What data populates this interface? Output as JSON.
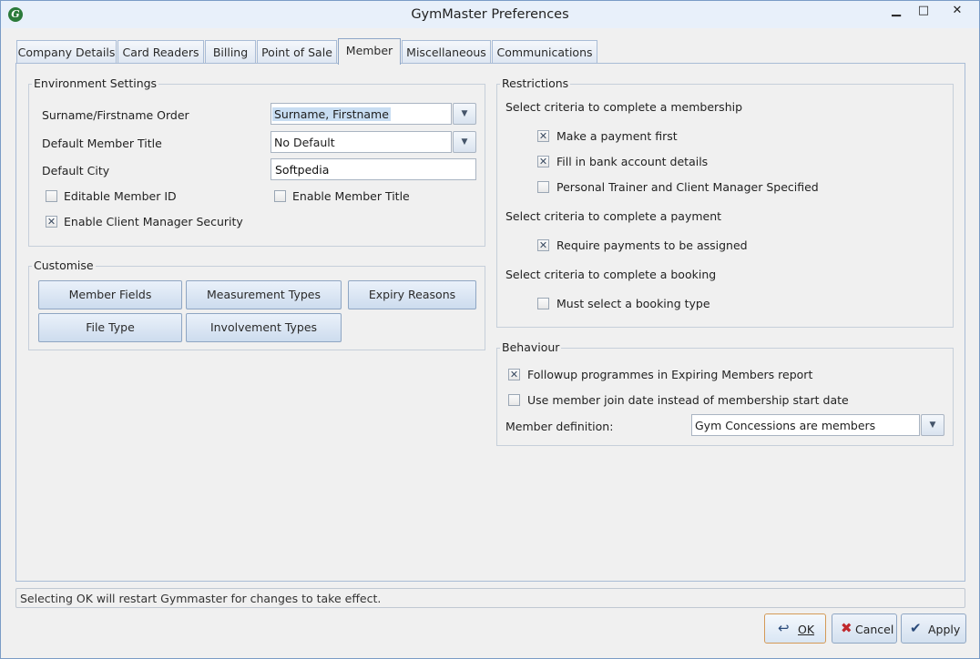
{
  "window": {
    "title": "GymMaster Preferences",
    "app_icon": "gymmaster-icon",
    "controls": {
      "minimize": "▁",
      "maximize": "□",
      "close": "✕"
    }
  },
  "tabs": [
    "Company Details",
    "Card Readers",
    "Billing",
    "Point of Sale",
    "Member",
    "Miscellaneous",
    "Communications"
  ],
  "active_tab": "Member",
  "environment": {
    "title": "Environment Settings",
    "surname_order_label": "Surname/Firstname Order",
    "surname_order_value": "Surname, Firstname",
    "member_title_label": "Default Member Title",
    "member_title_value": "No Default",
    "city_label": "Default City",
    "city_value": "Softpedia",
    "editable_member_id": {
      "label": "Editable Member ID",
      "checked": false
    },
    "enable_member_title": {
      "label": "Enable Member Title",
      "checked": false
    },
    "client_manager_security": {
      "label": "Enable Client Manager Security",
      "checked": true
    }
  },
  "customise": {
    "title": "Customise",
    "buttons": {
      "member_fields": "Member Fields",
      "measurement_types": "Measurement Types",
      "expiry_reasons": "Expiry Reasons",
      "file_type": "File Type",
      "involvement_types": "Involvement Types"
    }
  },
  "restrictions": {
    "title": "Restrictions",
    "membership_heading": "Select criteria to complete a membership",
    "make_payment_first": {
      "label": "Make a payment first",
      "checked": true
    },
    "fill_bank_details": {
      "label": "Fill in bank account details",
      "checked": true
    },
    "personal_trainer": {
      "label": "Personal Trainer and Client Manager Specified",
      "checked": false
    },
    "payment_heading": "Select criteria to complete a payment",
    "require_payments_assigned": {
      "label": "Require payments to be assigned",
      "checked": true
    },
    "booking_heading": "Select criteria to complete a booking",
    "booking_type": {
      "label": "Must select a booking type",
      "checked": false
    }
  },
  "behaviour": {
    "title": "Behaviour",
    "followup_programmes": {
      "label": "Followup programmes in Expiring Members report",
      "checked": true
    },
    "join_date": {
      "label": "Use member join date instead of membership start date",
      "checked": false
    },
    "member_definition_label": "Member definition:",
    "member_definition_value": "Gym Concessions are members"
  },
  "status_text": "Selecting OK will restart Gymmaster for changes to take effect.",
  "dialog_buttons": {
    "ok": "OK",
    "cancel": "Cancel",
    "apply": "Apply"
  },
  "symbols": {
    "check": "✕",
    "dropdown": "▼",
    "ok_icon": "↩",
    "cancel_icon": "✖",
    "apply_icon": "✔"
  }
}
